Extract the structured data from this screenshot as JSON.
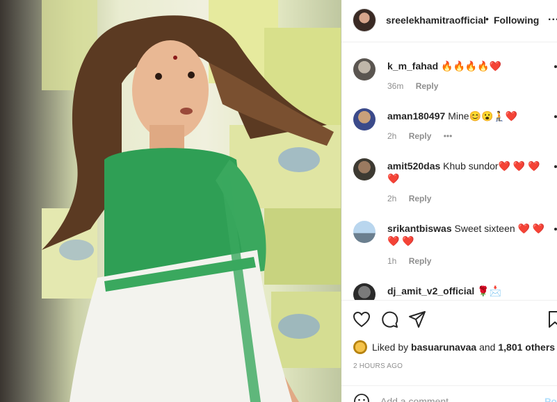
{
  "post": {
    "username": "sreelekhamitraofficial",
    "separator": "•",
    "follow_label": "Following",
    "more_label": "..."
  },
  "comments": [
    {
      "user": "k_m_fahad",
      "text": "🔥🔥🔥🔥❤️",
      "time": "36m",
      "reply": "Reply",
      "extra": ""
    },
    {
      "user": "aman180497",
      "text": "Mine😊😮🧎❤️",
      "time": "2h",
      "reply": "Reply",
      "extra": "•••"
    },
    {
      "user": "amit520das",
      "text": "Khub sundor❤️ ❤️ ❤️ ❤️",
      "time": "2h",
      "reply": "Reply",
      "extra": ""
    },
    {
      "user": "srikantbiswas",
      "text": "Sweet sixteen ❤️ ❤️ ❤️ ❤️",
      "time": "1h",
      "reply": "Reply",
      "extra": ""
    },
    {
      "user": "dj_amit_v2_official",
      "text": "🌹📩",
      "time": "",
      "reply": "",
      "extra": ""
    }
  ],
  "likes": {
    "prefix": "Liked by",
    "user": "basuarunavaa",
    "joiner": "and",
    "others": "1,801 others"
  },
  "timestamp": "2 HOURS AGO",
  "add_comment": {
    "placeholder": "Add a comment...",
    "post_label": "Post"
  },
  "icons": [
    "heart-icon",
    "comment-icon",
    "share-icon",
    "bookmark-icon",
    "emoji-icon"
  ]
}
